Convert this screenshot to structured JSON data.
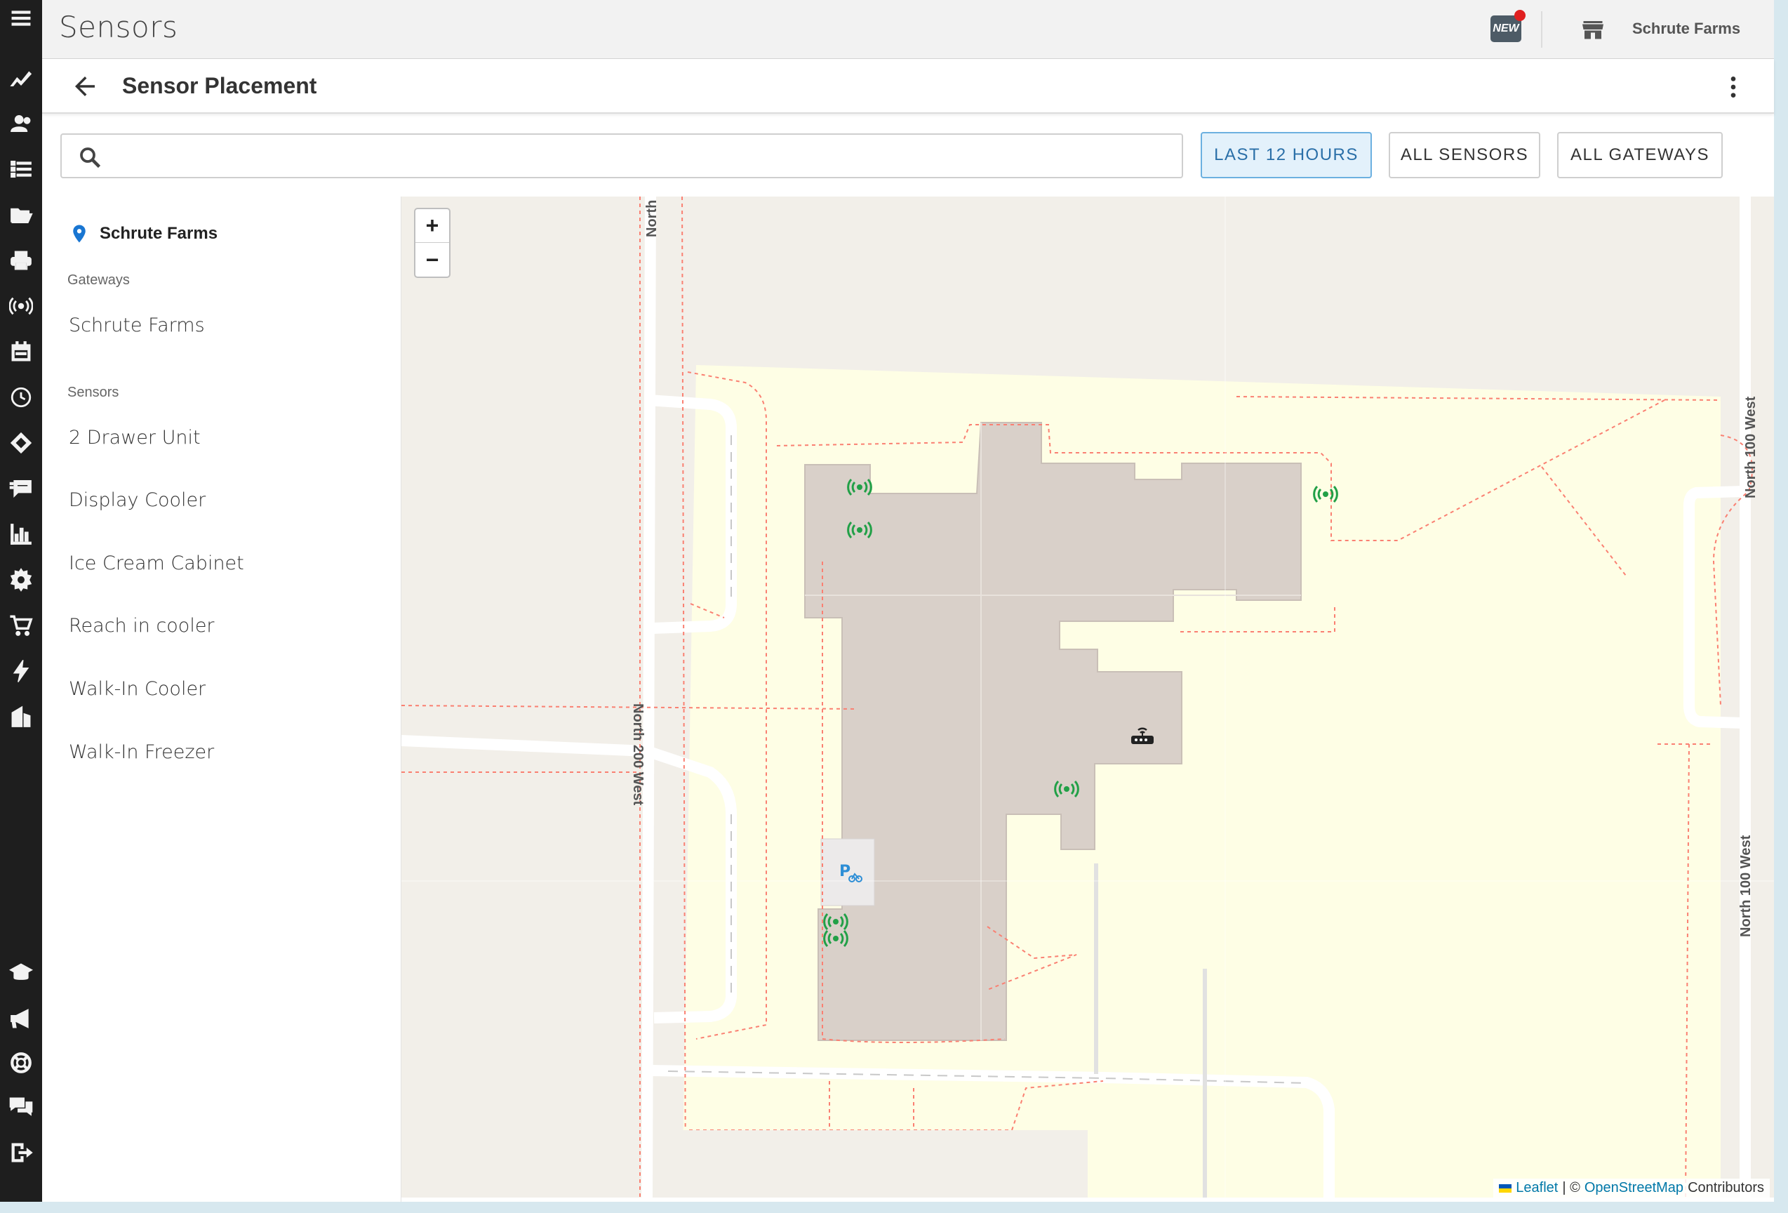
{
  "app": {
    "title": "Sensors",
    "new_badge": "NEW",
    "store_name": "Schrute Farms"
  },
  "nav_rail": [
    {
      "icon": "menu-icon"
    },
    {
      "icon": "trend-chart-icon"
    },
    {
      "icon": "users-icon"
    },
    {
      "icon": "checklist-icon"
    },
    {
      "icon": "folder-open-icon"
    },
    {
      "icon": "printer-icon"
    },
    {
      "icon": "sensor-broadcast-icon"
    },
    {
      "icon": "calendar-icon"
    },
    {
      "icon": "clock-icon"
    },
    {
      "icon": "ticket-icon"
    },
    {
      "icon": "feedback-icon"
    },
    {
      "icon": "bar-chart-icon"
    },
    {
      "icon": "gear-icon"
    },
    {
      "icon": "cart-icon"
    },
    {
      "icon": "lightning-icon"
    },
    {
      "icon": "buildings-icon"
    },
    {
      "icon": "graduation-cap-icon"
    },
    {
      "icon": "megaphone-icon"
    },
    {
      "icon": "lifebuoy-icon"
    },
    {
      "icon": "chat-bubbles-icon"
    },
    {
      "icon": "logout-icon"
    }
  ],
  "page": {
    "title": "Sensor Placement"
  },
  "toolbar": {
    "search_placeholder": "",
    "time_filter": "LAST 12 HOURS",
    "sensor_filter": "ALL SENSORS",
    "gateway_filter": "ALL GATEWAYS"
  },
  "side_panel": {
    "location": "Schrute Farms",
    "gateways_label": "Gateways",
    "gateways": [
      "Schrute Farms"
    ],
    "sensors_label": "Sensors",
    "sensors": [
      "2 Drawer Unit",
      "Display Cooler",
      "Ice Cream Cabinet",
      "Reach in cooler",
      "Walk-In Cooler",
      "Walk-In Freezer"
    ]
  },
  "map": {
    "zoom_in": "+",
    "zoom_out": "−",
    "streets": [
      "North",
      "North 200 West",
      "North 100 West",
      "North 100 West"
    ],
    "attribution": {
      "leaflet": "Leaflet",
      "separator": "| ©",
      "osm": "OpenStreetMap",
      "contributors": "Contributors"
    },
    "sensor_marker_color": "#22a047",
    "colors": {
      "building": "#d9d0c9",
      "site": "#fefee5",
      "ground": "#f2efe9",
      "path": "#fa8072"
    }
  },
  "colors": {
    "accent": "#2a6fa8",
    "rail": "#1e1e1e",
    "badge_dot": "#e02020"
  }
}
